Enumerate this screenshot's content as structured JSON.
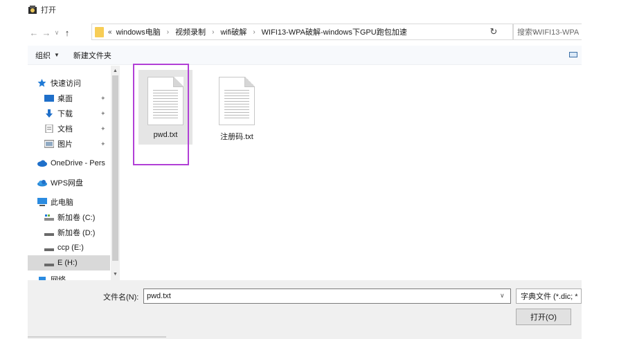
{
  "window": {
    "title": "打开"
  },
  "navigation": {
    "back_icon": "back-arrow-icon",
    "forward_icon": "forward-arrow-icon",
    "recent_icon": "chevron-down-icon",
    "up_icon": "up-arrow-icon",
    "breadcrumb_prefix": "«",
    "breadcrumbs": [
      "windows电脑",
      "视频录制",
      "wifi破解",
      "WIFI13-WPA破解-windows下GPU跑包加速"
    ],
    "search_placeholder": "搜索\"WIFI13-WPA"
  },
  "toolbar": {
    "organize": "组织",
    "new_folder": "新建文件夹"
  },
  "sidebar": {
    "items": [
      {
        "label": "快速访问",
        "icon": "star-icon"
      },
      {
        "label": "桌面",
        "icon": "desktop-icon",
        "pinned": true
      },
      {
        "label": "下载",
        "icon": "download-icon",
        "pinned": true
      },
      {
        "label": "文档",
        "icon": "document-icon",
        "pinned": true
      },
      {
        "label": "图片",
        "icon": "picture-icon",
        "pinned": true
      },
      {
        "label": "OneDrive - Pers",
        "icon": "cloud-icon"
      },
      {
        "label": "WPS网盘",
        "icon": "wps-cloud-icon"
      },
      {
        "label": "此电脑",
        "icon": "computer-icon"
      },
      {
        "label": "新加卷 (C:)",
        "icon": "drive-icon"
      },
      {
        "label": "新加卷 (D:)",
        "icon": "drive-icon"
      },
      {
        "label": "ccp (E:)",
        "icon": "drive-icon"
      },
      {
        "label": "E (H:)",
        "icon": "drive-icon",
        "selected": true
      },
      {
        "label": "网络",
        "icon": "network-icon"
      }
    ]
  },
  "files": [
    {
      "name": "pwd.txt",
      "selected": true
    },
    {
      "name": "注册码.txt",
      "selected": false
    }
  ],
  "bottom": {
    "filename_label": "文件名(N):",
    "filename_value": "pwd.txt",
    "filter_value": "字典文件 (*.dic; *",
    "open_button": "打开(O)"
  },
  "colors": {
    "highlight": "#b13fd6",
    "selection": "#e5e5e5",
    "folder": "#f7cd56",
    "accent": "#0067c0"
  }
}
